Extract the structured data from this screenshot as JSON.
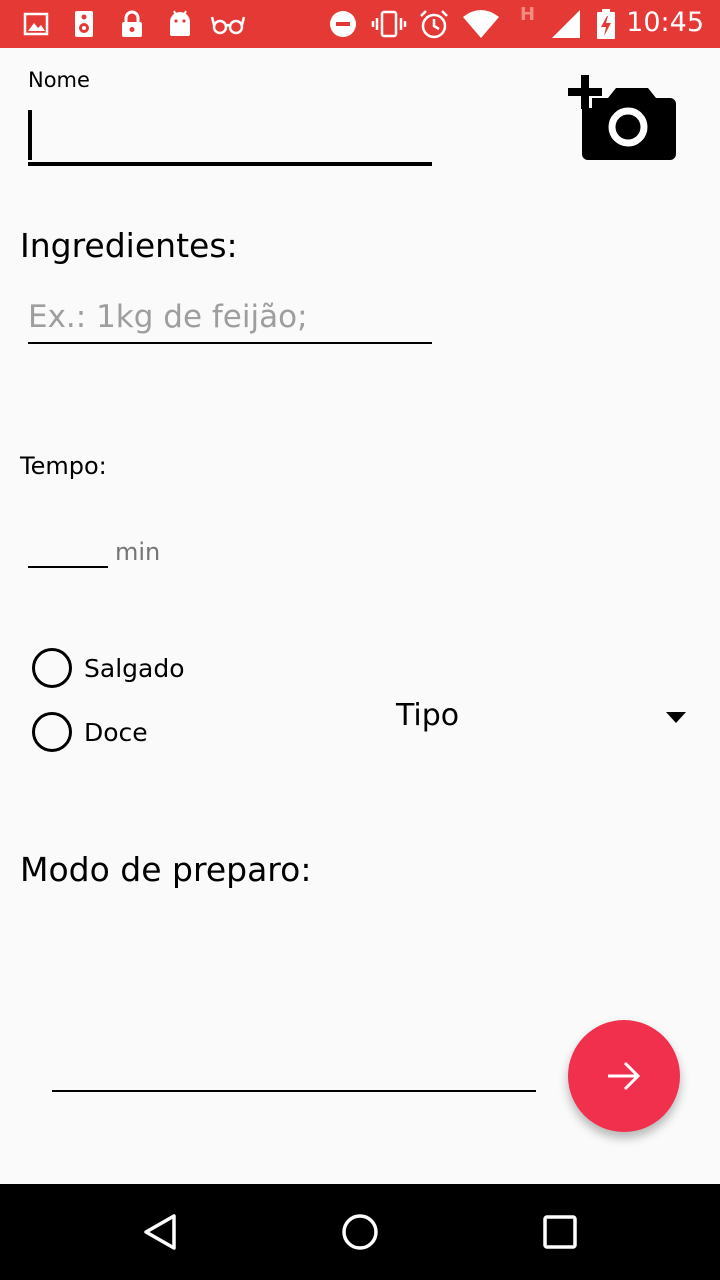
{
  "status_bar": {
    "time": "10:45",
    "notification_icons": [
      "image-icon",
      "speaker-icon",
      "lock-icon",
      "android-icon",
      "glasses-icon"
    ],
    "system_icons": [
      "do-not-disturb-icon",
      "vibrate-icon",
      "alarm-icon",
      "wifi-icon",
      "signal-h-icon",
      "cell-signal-icon",
      "battery-charging-icon"
    ],
    "network_type": "H",
    "background_color": "#e53935"
  },
  "form": {
    "nome": {
      "label": "Nome",
      "value": ""
    },
    "camera_button_icon": "add-a-photo-icon",
    "ingredientes": {
      "heading": "Ingredientes:",
      "placeholder": "Ex.: 1kg de feijão;",
      "value": ""
    },
    "tempo": {
      "label": "Tempo:",
      "value": "",
      "unit": "min"
    },
    "tipo_radio": [
      {
        "label": "Salgado",
        "checked": false
      },
      {
        "label": "Doce",
        "checked": false
      }
    ],
    "tipo_spinner": {
      "selected": "Tipo"
    },
    "modo_preparo": {
      "heading": "Modo de preparo:",
      "value": ""
    }
  },
  "fab": {
    "icon": "arrow-forward-icon",
    "color": "#f0304c"
  },
  "nav_bar": {
    "buttons": [
      "back-icon",
      "home-icon",
      "recents-icon"
    ]
  }
}
